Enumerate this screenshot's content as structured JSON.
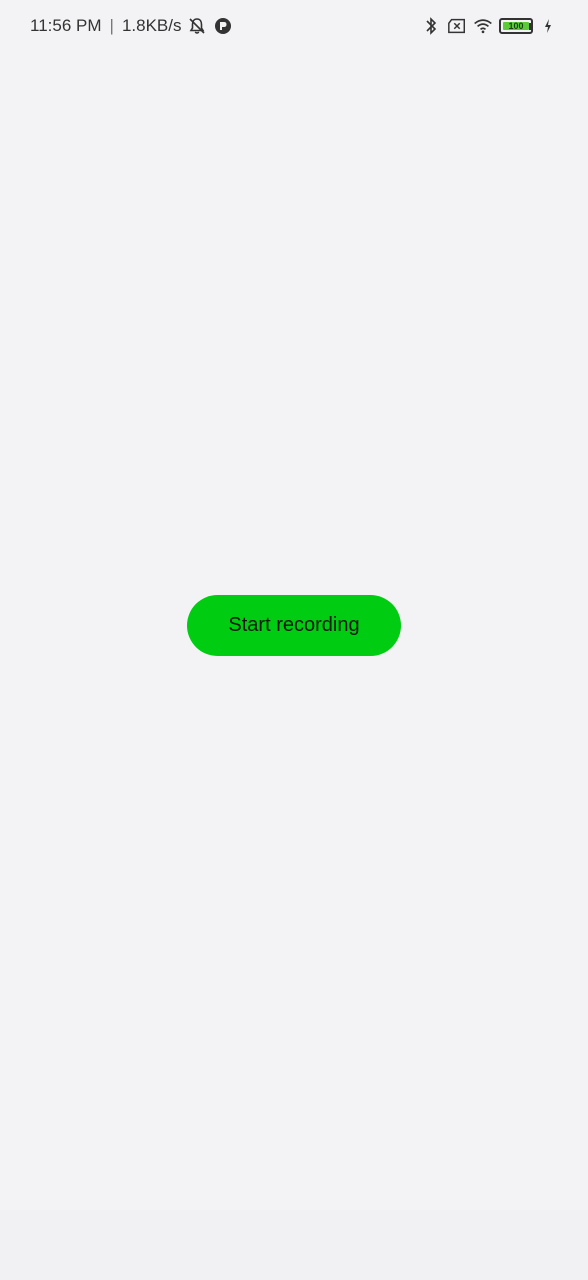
{
  "status_bar": {
    "time": "11:56 PM",
    "separator": "|",
    "network_speed": "1.8KB/s",
    "icons_left": [
      "bell-off-icon",
      "app-notification-icon"
    ],
    "icons_right": [
      "bluetooth-icon",
      "no-sim-icon",
      "wifi-icon",
      "battery-icon",
      "charging-icon"
    ],
    "battery_level": "100",
    "battery_color": "#5ccb3a"
  },
  "main": {
    "record_button_label": "Start recording",
    "button_color": "#00cc11"
  }
}
